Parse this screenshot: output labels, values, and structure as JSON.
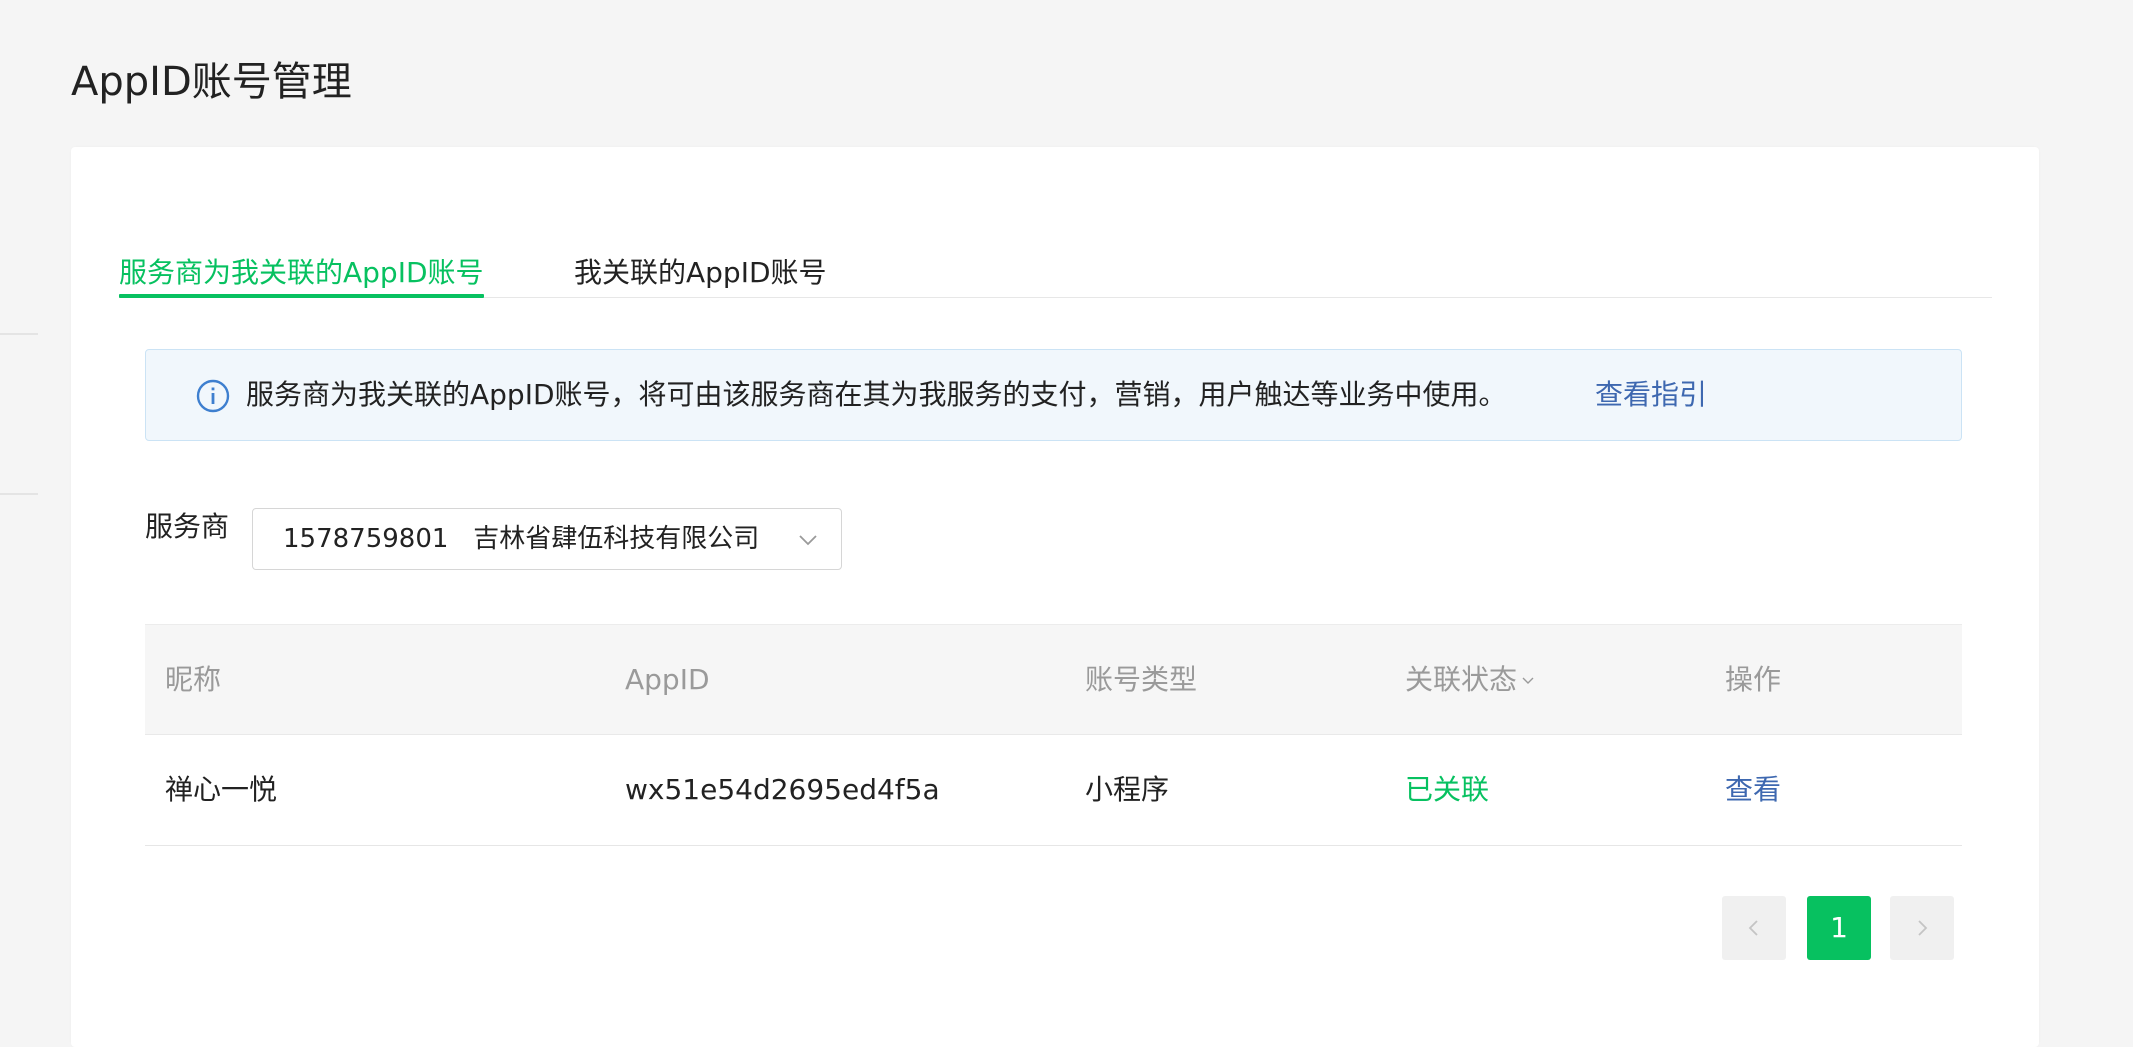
{
  "page": {
    "title": "AppID账号管理"
  },
  "tabs": [
    {
      "label": "服务商为我关联的AppID账号",
      "active": true
    },
    {
      "label": "我关联的AppID账号",
      "active": false
    }
  ],
  "notice": {
    "icon": "info-icon",
    "text": "服务商为我关联的AppID账号，将可由该服务商在其为我服务的支付，营销，用户触达等业务中使用。",
    "link_label": "查看指引"
  },
  "filter": {
    "label": "服务商",
    "selected_value": "1578759801   吉林省肆伍科技有限公司",
    "icon": "chevron-down-icon"
  },
  "table": {
    "headers": [
      "昵称",
      "AppID",
      "账号类型",
      "关联状态",
      "操作"
    ],
    "rows": [
      {
        "nickname": "禅心一悦",
        "appid": "wx51e54d2695ed4f5a",
        "account_type": "小程序",
        "status": "已关联",
        "action": "查看"
      }
    ]
  },
  "pagination": {
    "current_page": "1"
  },
  "colors": {
    "accent": "#07c160",
    "link": "#3e68b0",
    "notice_bg": "#f1f7fc"
  }
}
